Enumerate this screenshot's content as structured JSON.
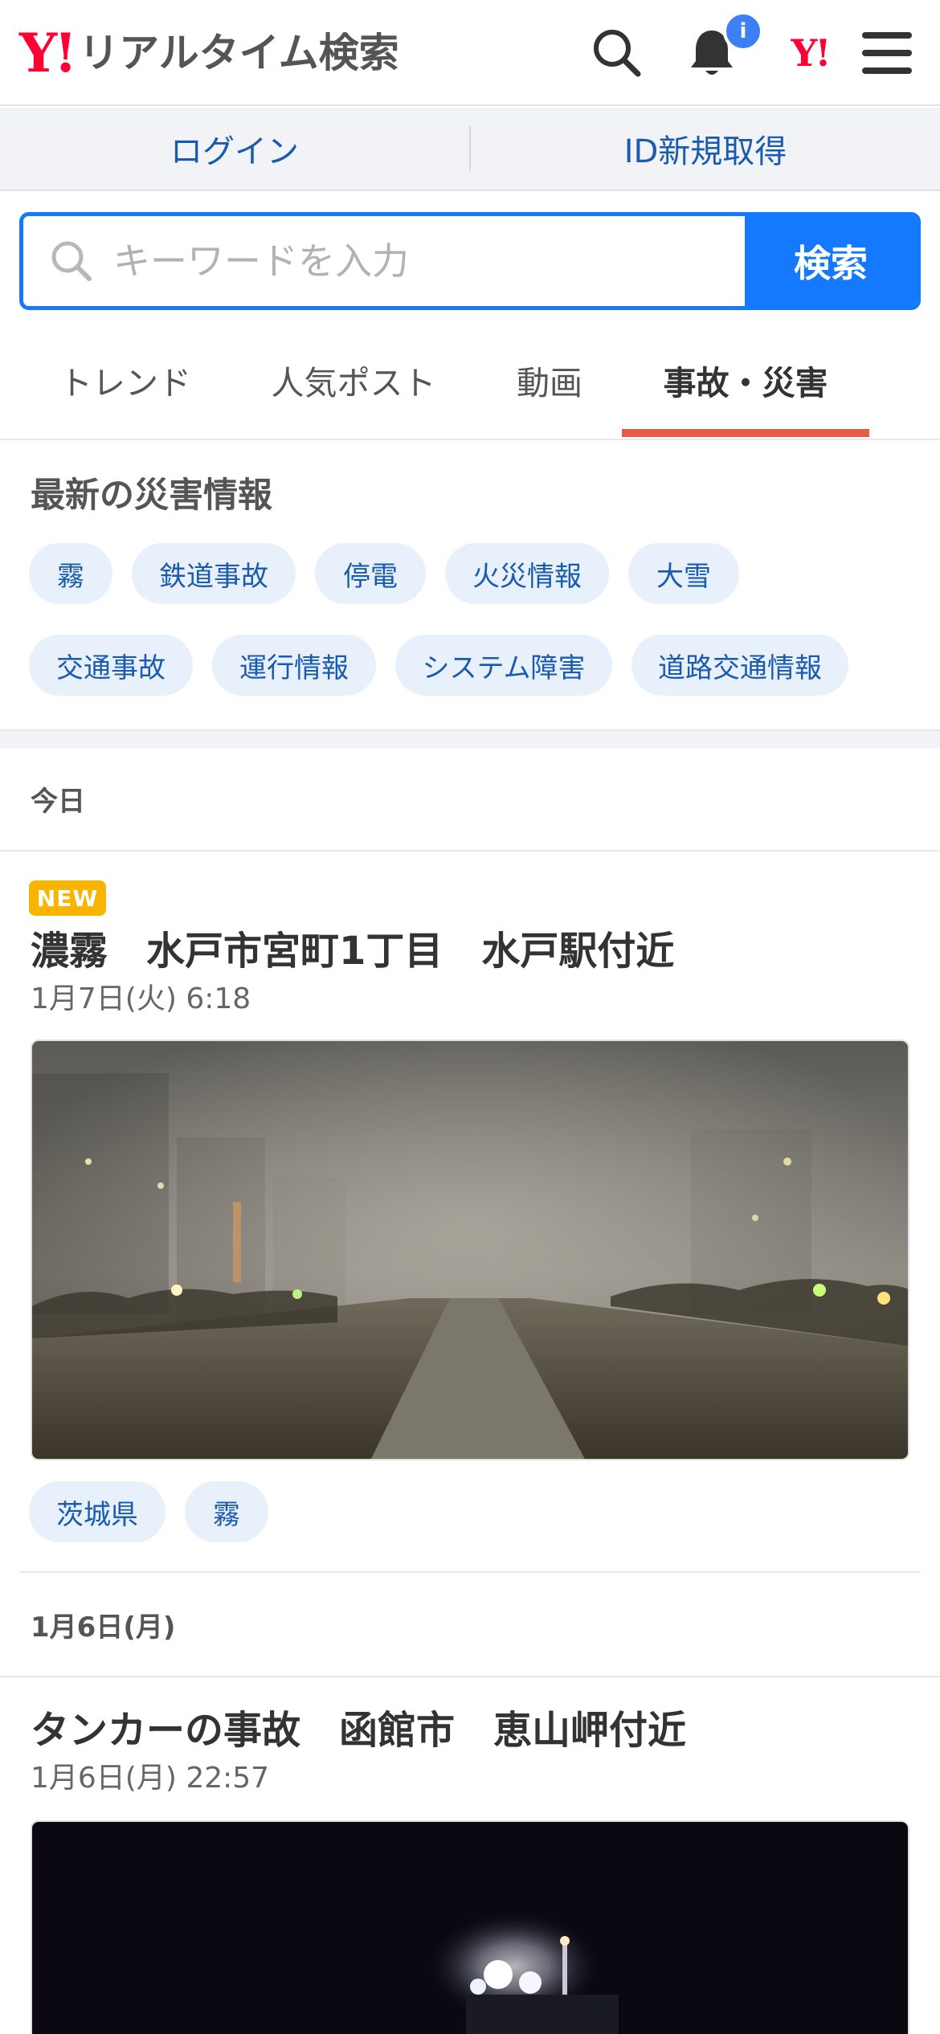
{
  "header": {
    "logo_mark": "Y!",
    "logo_text": "リアルタイム検索",
    "notification_badge": "i",
    "yahoo_mark": "Y!"
  },
  "auth": {
    "login": "ログイン",
    "register": "ID新規取得"
  },
  "search": {
    "placeholder": "キーワードを入力",
    "button": "検索"
  },
  "tabs": [
    "トレンド",
    "人気ポスト",
    "動画",
    "事故・災害"
  ],
  "active_tab": "事故・災害",
  "disaster": {
    "title": "最新の災害情報",
    "chips": [
      "霧",
      "鉄道事故",
      "停電",
      "火災情報",
      "大雪",
      "交通事故",
      "運行情報",
      "システム障害",
      "道路交通情報"
    ]
  },
  "feed": {
    "today_label": "今日",
    "posts": [
      {
        "badge": "NEW",
        "title": "濃霧　水戸市宮町1丁目　水戸駅付近",
        "time": "1月7日(火) 6:18",
        "tags": [
          "茨城県",
          "霧"
        ]
      },
      {
        "title": "タンカーの事故　函館市　恵山岬付近",
        "time": "1月6日(月) 22:57"
      }
    ],
    "day2_label": "1月6日(月)"
  },
  "colors": {
    "brand_red": "#ff0033",
    "accent_blue": "#1479ff",
    "link_blue": "#1a5bb0",
    "chip_bg": "#e7f0fb",
    "tab_underline": "#e25b4b",
    "new_badge": "#f7b500"
  }
}
